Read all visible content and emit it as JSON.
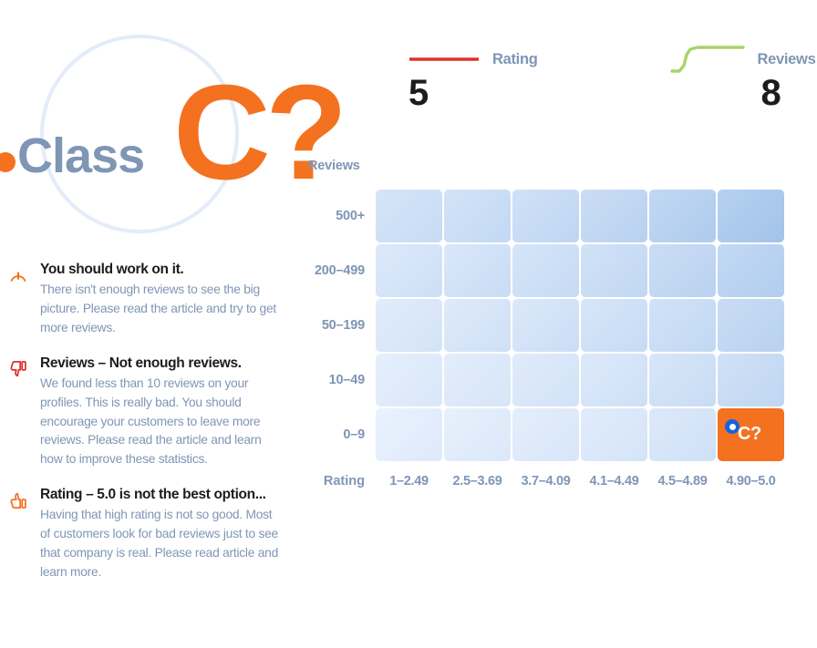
{
  "hero": {
    "class_word": "Class",
    "grade": "C?",
    "dot_color": "#f4711f",
    "class_color": "#7f96b5",
    "circle_color": "#e4ecfa"
  },
  "stats": [
    {
      "label": "Rating",
      "value": "5",
      "spark_type": "flat-line",
      "color": "#e03028",
      "icon": "rating-sparkline-icon"
    },
    {
      "label": "Reviews per profile",
      "value": "8",
      "spark_type": "step-curve",
      "color": "#a8d468",
      "icon": "reviews-sparkline-icon"
    }
  ],
  "chart_data": {
    "type": "heatmap",
    "title": "",
    "xlabel": "Rating",
    "ylabel": "Reviews",
    "x_categories": [
      "1–2.49",
      "2.5–3.69",
      "3.7–4.09",
      "4.1–4.49",
      "4.5–4.89",
      "4.90–5.0"
    ],
    "y_categories": [
      "500+",
      "200–499",
      "50–199",
      "10–49",
      "0–9"
    ],
    "legend": "none",
    "grid": false,
    "cell_colors": [
      [
        "#cfe0f6",
        "#cbdef6",
        "#c7dbf5",
        "#c1d8f4",
        "#b5d0f1",
        "#a8c8ec"
      ],
      [
        "#d5e4f8",
        "#d2e2f7",
        "#cfe0f6",
        "#cadef5",
        "#c4daf4",
        "#bdd5f2"
      ],
      [
        "#dbe8f9",
        "#d8e6f8",
        "#d5e4f8",
        "#d1e1f7",
        "#ccdef6",
        "#c6daf4"
      ],
      [
        "#e0ebfb",
        "#deeafa",
        "#dbe8f9",
        "#d8e6f8",
        "#d3e3f7",
        "#cedff6"
      ],
      [
        "#e4eefc",
        "#e2ecfb",
        "#e0ebfb",
        "#dde9fa",
        "#d9e6f9",
        "#f4711f"
      ]
    ],
    "values": [
      [
        2,
        3,
        4,
        5,
        7,
        9
      ],
      [
        2,
        2,
        3,
        4,
        5,
        6
      ],
      [
        1,
        2,
        2,
        3,
        4,
        5
      ],
      [
        1,
        1,
        2,
        2,
        3,
        4
      ],
      [
        1,
        1,
        1,
        1,
        2,
        10
      ]
    ],
    "highlight": {
      "row": "0–9",
      "column": "4.90–5.0",
      "label": "C?",
      "cell_color": "#f4711f",
      "marker_color": "#1363df"
    }
  },
  "advice": [
    {
      "icon": "gauge-icon",
      "icon_color": "#f4711f",
      "title": "You should work on it.",
      "text": "There isn't enough reviews to see the big picture. Please read the article and try to get more reviews."
    },
    {
      "icon": "thumbs-down-icon",
      "icon_color": "#e03028",
      "title": "Reviews – Not enough reviews.",
      "text": "We found less than 10 reviews on your profiles. This is really bad. You should encourage your customers to leave more reviews. Please read the article and learn how to improve these statistics."
    },
    {
      "icon": "thumbs-up-icon",
      "icon_color": "#f4711f",
      "title": "Rating – 5.0 is not the best option...",
      "text": "Having that high rating is not so good. Most of customers look for bad reviews just to see that company is real. Please read article and learn more."
    }
  ]
}
